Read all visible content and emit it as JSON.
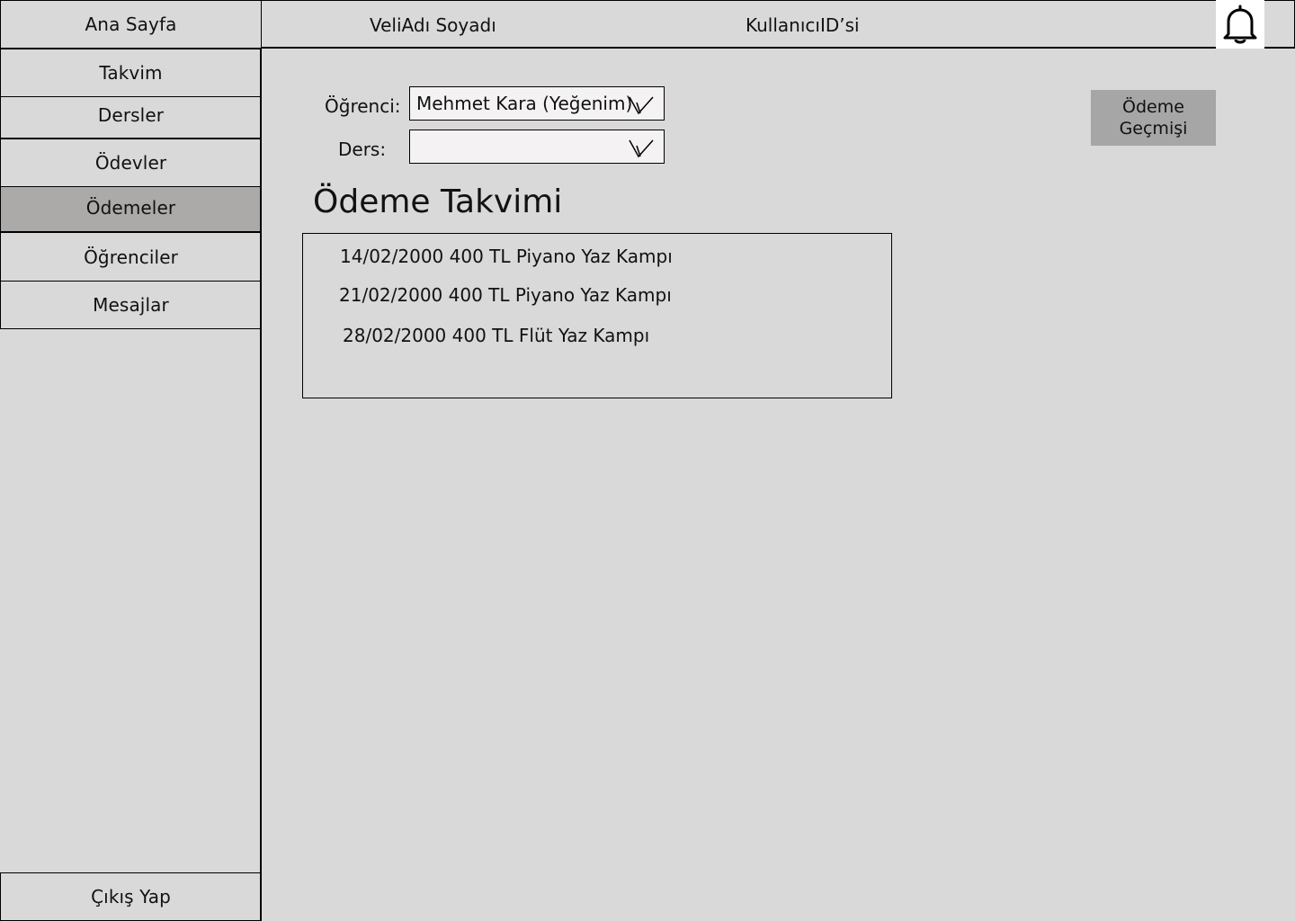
{
  "sidebar": {
    "home_label": "Ana Sayfa",
    "items": [
      {
        "label": "Takvim"
      },
      {
        "label": "Dersler"
      },
      {
        "label": "Ödevler"
      },
      {
        "label": "Ödemeler"
      },
      {
        "label": "Öğrenciler"
      },
      {
        "label": "Mesajlar"
      }
    ],
    "active_item": "Ödemeler",
    "logout_label": "Çıkış Yap"
  },
  "header": {
    "parent_name": "VeliAdı Soyadı",
    "user_id": "KullanıcıID’si",
    "notification_icon": "bell-icon"
  },
  "filters": {
    "student_label": "Öğrenci:",
    "student_value": "Mehmet Kara (Yeğenim)",
    "course_label": "Ders:",
    "course_value": ""
  },
  "actions": {
    "payment_history_line1": "Ödeme",
    "payment_history_line2": "Geçmişi"
  },
  "schedule": {
    "title": "Ödeme Takvimi",
    "items": [
      {
        "text": "14/02/2000 400 TL Piyano Yaz Kampı"
      },
      {
        "text": "21/02/2000 400 TL Piyano Yaz Kampı"
      },
      {
        "text": "28/02/2000 400 TL Flüt Yaz Kampı"
      }
    ]
  },
  "colors": {
    "background": "#d9d9d9",
    "active_nav": "#aca9a9",
    "history_button": "#a6a6a6",
    "select_bg": "#f4f2f2"
  }
}
